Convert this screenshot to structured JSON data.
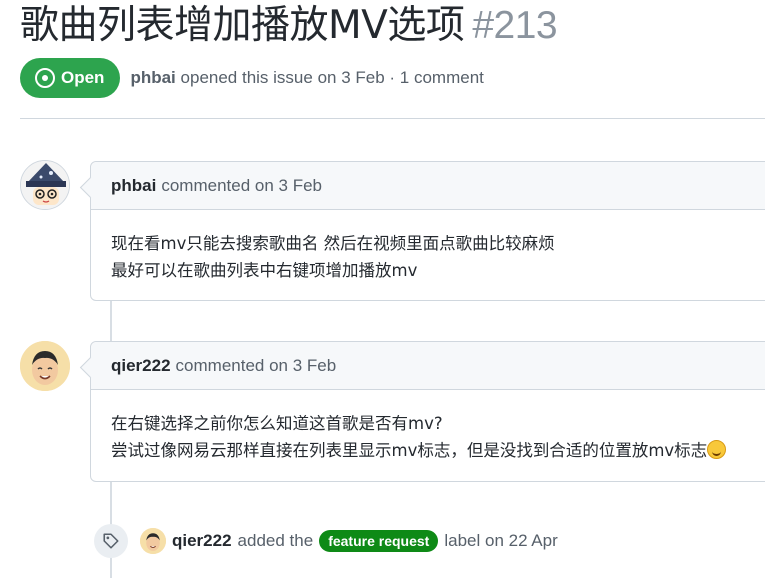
{
  "issue": {
    "title": "歌曲列表增加播放MV选项",
    "number": "#213",
    "state": "Open",
    "author": "phbai",
    "opened_text": "opened this issue on 3 Feb · 1 comment"
  },
  "comments": [
    {
      "author": "phbai",
      "meta": "commented on 3 Feb",
      "lines": [
        "现在看mv只能去搜索歌曲名 然后在视频里面点歌曲比较麻烦",
        "最好可以在歌曲列表中右键项增加播放mv"
      ]
    },
    {
      "author": "qier222",
      "meta": "commented on 3 Feb",
      "lines": [
        "在右键选择之前你怎么知道这首歌是否有mv?",
        "尝试过像网易云那样直接在列表里显示mv标志，但是没找到合适的位置放mv标志"
      ]
    }
  ],
  "event": {
    "author": "qier222",
    "action": "added the",
    "label": "feature request",
    "suffix": "label on 22 Apr"
  },
  "colors": {
    "open_green": "#2da44e",
    "label_green": "#0e8a16",
    "border": "#d0d7de"
  },
  "icons": [
    "issue-opened-icon",
    "tag-icon",
    "grinning-sweat-emoji"
  ]
}
